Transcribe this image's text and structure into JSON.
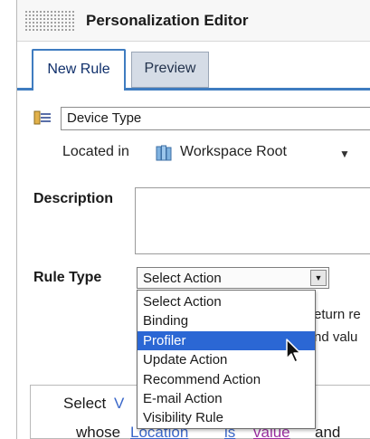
{
  "window": {
    "title": "Personalization Editor"
  },
  "tabs": [
    {
      "label": "New Rule",
      "active": true
    },
    {
      "label": "Preview",
      "active": false
    }
  ],
  "resource": {
    "value": "Device Type"
  },
  "location": {
    "prefix": "Located in",
    "folder": "Workspace Root"
  },
  "description": {
    "label": "Description",
    "value": ""
  },
  "rule_type": {
    "label": "Rule Type",
    "selected": "Select Action",
    "options": [
      "Select Action",
      "Binding",
      "Profiler",
      "Update Action",
      "Recommend Action",
      "E-mail Action",
      "Visibility Rule"
    ],
    "highlighted": "Profiler"
  },
  "partial_hints": {
    "line1": "eturn re",
    "line2": "nd valu"
  },
  "rule_panel": {
    "line1_select": "Select",
    "line1_var": "V",
    "line2_whose": "whose",
    "line2_location": "Location",
    "line2_is": "is",
    "line2_value": "value",
    "line2_and": "and"
  },
  "colors": {
    "accent": "#3f7cc0",
    "selection": "#2b67d4",
    "keyword_blue": "#3a67c9",
    "value_purple": "#9a2fa0"
  },
  "icons": {
    "resource": "rule-resource-icon",
    "folder": "workspace-folder-icon",
    "caret": "chevron-down-icon"
  }
}
